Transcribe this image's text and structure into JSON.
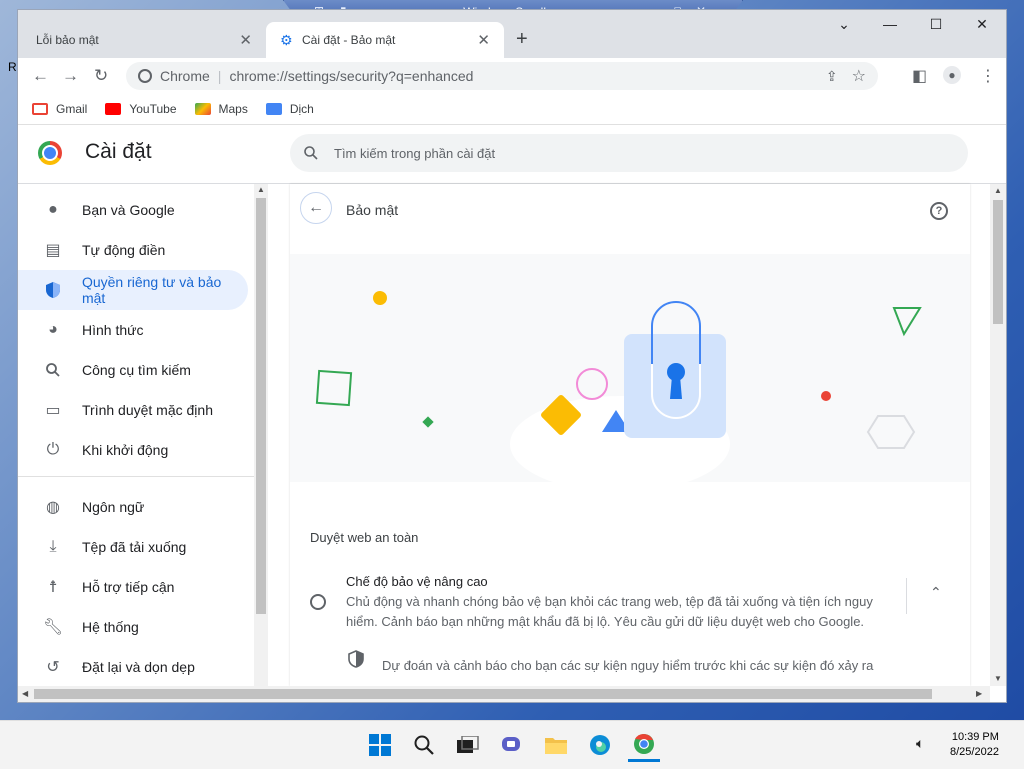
{
  "sandbox": {
    "title": "Windows Sandbox"
  },
  "desktop": {
    "edge_letter": "R"
  },
  "tabs": [
    {
      "title": "Lỗi bảo mật"
    },
    {
      "title": "Cài đặt - Bảo mật"
    }
  ],
  "toolbar": {
    "site_label": "Chrome",
    "url": "chrome://settings/security?q=enhanced"
  },
  "bookmarks": [
    {
      "label": "Gmail",
      "color": "#ea4335"
    },
    {
      "label": "YouTube",
      "color": "#ff0000"
    },
    {
      "label": "Maps",
      "color": "#34a853"
    },
    {
      "label": "Dịch",
      "color": "#4285f4"
    }
  ],
  "settings": {
    "title": "Cài đặt",
    "search_placeholder": "Tìm kiếm trong phần cài đặt"
  },
  "sidebar": {
    "items": [
      {
        "label": "Bạn và Google",
        "icon": "person-icon"
      },
      {
        "label": "Tự động điền",
        "icon": "clipboard-icon"
      },
      {
        "label": "Quyền riêng tư và bảo mật",
        "icon": "shield-icon",
        "active": true
      },
      {
        "label": "Hình thức",
        "icon": "palette-icon"
      },
      {
        "label": "Công cụ tìm kiếm",
        "icon": "search-icon"
      },
      {
        "label": "Trình duyệt mặc định",
        "icon": "browser-icon"
      },
      {
        "label": "Khi khởi động",
        "icon": "power-icon"
      },
      {
        "label": "Ngôn ngữ",
        "icon": "globe-icon"
      },
      {
        "label": "Tệp đã tải xuống",
        "icon": "download-icon"
      },
      {
        "label": "Hỗ trợ tiếp cận",
        "icon": "accessibility-icon"
      },
      {
        "label": "Hệ thống",
        "icon": "wrench-icon"
      },
      {
        "label": "Đặt lại và dọn dẹp",
        "icon": "restore-icon"
      }
    ]
  },
  "main": {
    "page_title": "Bảo mật",
    "section_title": "Duyệt web an toàn",
    "option": {
      "title": "Chế độ bảo vệ nâng cao",
      "description": "Chủ động và nhanh chóng bảo vệ bạn khỏi các trang web, tệp đã tải xuống và tiện ích nguy hiểm. Cảnh báo bạn những mật khẩu đã bị lộ. Yêu cầu gửi dữ liệu duyệt web cho Google.",
      "detail": "Dự đoán và cảnh báo cho bạn các sự kiện nguy hiểm trước khi các sự kiện đó xảy ra"
    }
  },
  "taskbar": {
    "time": "10:39 PM",
    "date": "8/25/2022",
    "apps": [
      "start-icon",
      "search-icon",
      "task-view-icon",
      "chat-icon",
      "file-explorer-icon",
      "edge-icon",
      "chrome-icon"
    ]
  },
  "colors": {
    "accent": "#1a73e8",
    "active_bg": "#e8f0fe"
  }
}
